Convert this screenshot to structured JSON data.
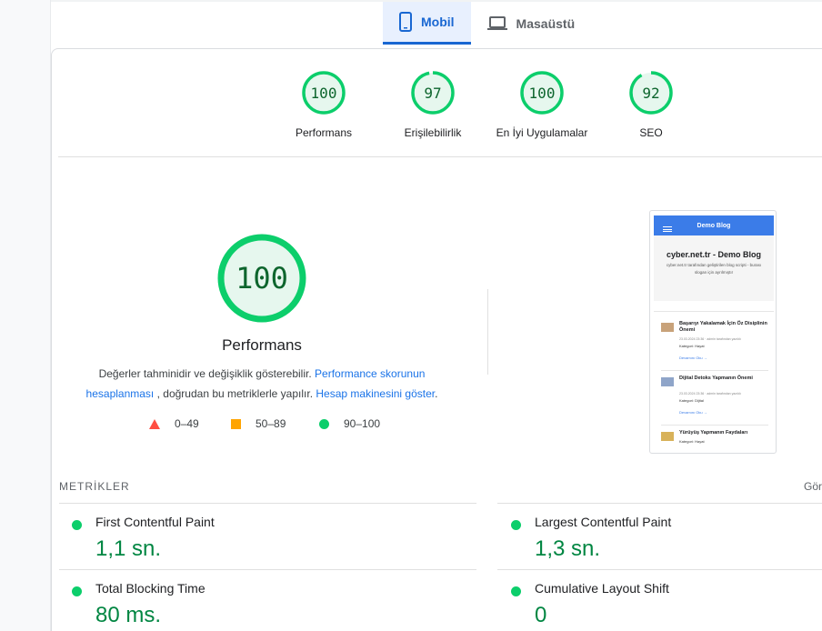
{
  "tabs": [
    {
      "label": "Mobil",
      "icon": "phone-icon",
      "active": true
    },
    {
      "label": "Masaüstü",
      "icon": "laptop-icon",
      "active": false
    }
  ],
  "categories": [
    {
      "score": "100",
      "label": "Performans",
      "value": 100
    },
    {
      "score": "97",
      "label": "Erişilebilirlik",
      "value": 97
    },
    {
      "score": "100",
      "label": "En İyi Uygulamalar",
      "value": 100
    },
    {
      "score": "92",
      "label": "SEO",
      "value": 92
    }
  ],
  "performance": {
    "score": "100",
    "title": "Performans",
    "desc_part1": "Değerler tahminidir ve değişiklik gösterebilir.",
    "desc_link1": "Performance skorunun hesaplanması",
    "desc_part2": ", doğrudan bu metriklerle yapılır.",
    "desc_link2": "Hesap makinesini göster",
    "desc_end": "."
  },
  "legend": [
    {
      "range": "0–49",
      "shape": "triangle",
      "color": "#ff4e42"
    },
    {
      "range": "50–89",
      "shape": "square",
      "color": "#ffa400"
    },
    {
      "range": "90–100",
      "shape": "circle",
      "color": "#0cce6b"
    }
  ],
  "screenshot": {
    "header": "Demo Blog",
    "site_title": "cyber.net.tr - Demo Blog",
    "site_subtitle": "cyber.net.tr tarafından geliştirilen blog scripti - burası slogan için ayrılmıştır",
    "posts": [
      {
        "title": "Başarıyı Yakalamak İçin Öz Disiplinin Önemi",
        "meta": "23.03.2024 23:36 · admin tarafından yazıldı",
        "category": "Kategori: Hayat",
        "more": "Devamını Oku →"
      },
      {
        "title": "Dijital Detoks Yapmanın Önemi",
        "meta": "23.03.2024 23:36 · admin tarafından yazıldı",
        "category": "Kategori: Dijital",
        "more": "Devamını Oku →"
      },
      {
        "title": "Yürüyüş Yapmanın Faydaları",
        "meta": "",
        "category": "Kategori: Hayat",
        "more": ""
      }
    ]
  },
  "metrics": {
    "title": "METRİKLER",
    "expand_label": "Gör",
    "items": [
      {
        "label": "First Contentful Paint",
        "value": "1,1 sn."
      },
      {
        "label": "Largest Contentful Paint",
        "value": "1,3 sn."
      },
      {
        "label": "Total Blocking Time",
        "value": "80 ms."
      },
      {
        "label": "Cumulative Layout Shift",
        "value": "0"
      }
    ]
  },
  "colors": {
    "pass": "#0cce6b",
    "pass_text": "#018642",
    "accent": "#1a73e8"
  }
}
